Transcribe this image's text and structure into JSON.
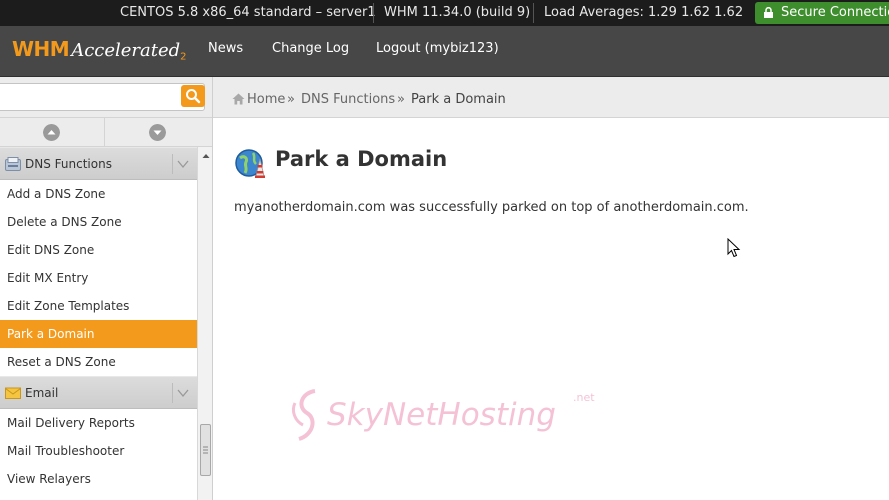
{
  "statusbar": {
    "system": "CENTOS 5.8 x86_64 standard – server1",
    "version": "WHM 11.34.0 (build 9)",
    "load": "Load Averages: 1.29 1.62 1.62",
    "secure": "Secure Connection"
  },
  "header": {
    "logo_whm": "WHM",
    "logo_accelerated": "Accelerated",
    "logo_version": "2",
    "nav": [
      {
        "label": "News"
      },
      {
        "label": "Change Log"
      },
      {
        "label": "Logout (mybiz123)"
      }
    ]
  },
  "search": {
    "value": "",
    "placeholder": ""
  },
  "sidebar": {
    "categories": [
      {
        "label": "DNS Functions",
        "icon": "dns-icon",
        "items": [
          {
            "label": "Add a DNS Zone"
          },
          {
            "label": "Delete a DNS Zone"
          },
          {
            "label": "Edit DNS Zone"
          },
          {
            "label": "Edit MX Entry"
          },
          {
            "label": "Edit Zone Templates"
          },
          {
            "label": "Park a Domain",
            "active": true
          },
          {
            "label": "Reset a DNS Zone"
          }
        ]
      },
      {
        "label": "Email",
        "icon": "envelope-icon",
        "items": [
          {
            "label": "Mail Delivery Reports"
          },
          {
            "label": "Mail Troubleshooter"
          },
          {
            "label": "View Relayers"
          }
        ]
      }
    ]
  },
  "breadcrumb": {
    "home": "Home",
    "sep": "»",
    "section": "DNS Functions",
    "current": "Park a Domain"
  },
  "content": {
    "title": "Park a Domain",
    "message": "myanotherdomain.com was successfully parked on top of anotherdomain.com."
  },
  "watermark": {
    "text": "SkyNetHosting",
    "suffix": ".net"
  },
  "colors": {
    "accent": "#f39a1c",
    "secure": "#3e8e2e",
    "header": "#474747",
    "statusbar": "#1c1c1c"
  }
}
